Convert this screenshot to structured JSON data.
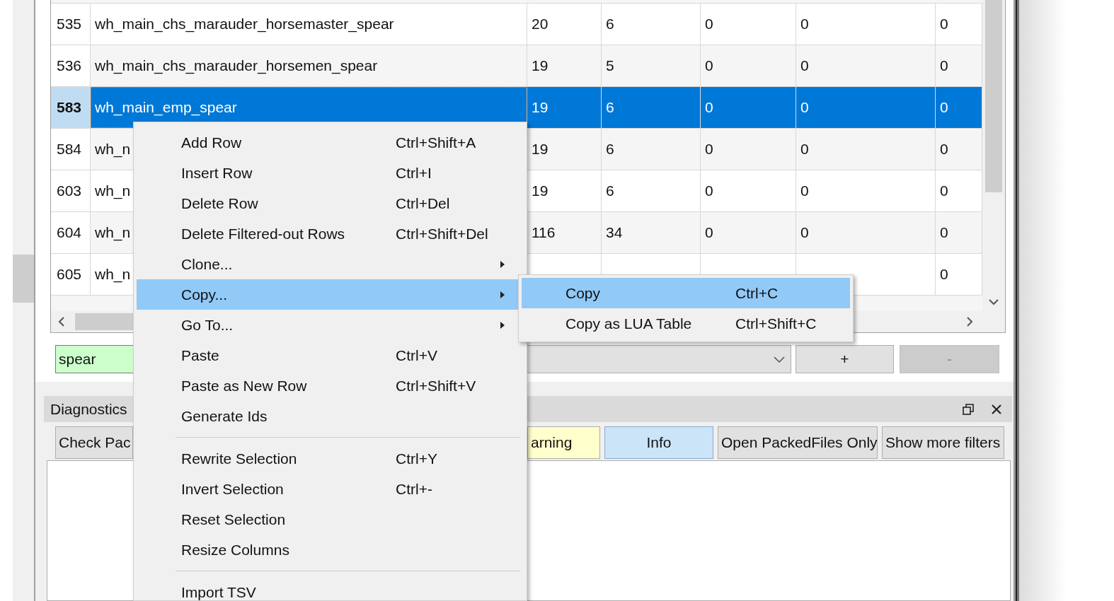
{
  "table": {
    "rows": [
      {
        "header": "535",
        "selected": false,
        "cells": [
          "wh_main_chs_marauder_horsemaster_spear",
          "20",
          "6",
          "0",
          "0",
          "0"
        ]
      },
      {
        "header": "536",
        "selected": false,
        "cells": [
          "wh_main_chs_marauder_horsemen_spear",
          "19",
          "5",
          "0",
          "0",
          "0"
        ]
      },
      {
        "header": "583",
        "selected": true,
        "cells": [
          "wh_main_emp_spear",
          "19",
          "6",
          "0",
          "0",
          "0"
        ]
      },
      {
        "header": "584",
        "selected": false,
        "cells": [
          "wh_n",
          "19",
          "6",
          "0",
          "0",
          "0"
        ]
      },
      {
        "header": "603",
        "selected": false,
        "cells": [
          "wh_n",
          "19",
          "6",
          "0",
          "0",
          "0"
        ]
      },
      {
        "header": "604",
        "selected": false,
        "cells": [
          "wh_n",
          "116",
          "34",
          "0",
          "0",
          "0"
        ]
      },
      {
        "header": "605",
        "selected": false,
        "cells": [
          "wh_n"
        ],
        "column_6": "0"
      }
    ]
  },
  "filter": {
    "value": "spear",
    "add_button": {
      "label": "+",
      "disabled": false
    },
    "remove_button": {
      "label": "-",
      "disabled": true
    }
  },
  "diagnostics": {
    "title": "Diagnostics",
    "buttons": [
      {
        "label": "Check Pac",
        "kind": "plain"
      },
      {
        "label": "arning",
        "kind": "warning"
      },
      {
        "label": "Info",
        "kind": "info"
      },
      {
        "label": "Open PackedFiles Only",
        "kind": "plain"
      },
      {
        "label": "Show more filters",
        "kind": "plain"
      }
    ]
  },
  "context_menu": {
    "items": [
      {
        "kind": "item",
        "label": "Add Row",
        "shortcut": "Ctrl+Shift+A",
        "submenu": false,
        "selected": false
      },
      {
        "kind": "item",
        "label": "Insert Row",
        "shortcut": "Ctrl+I",
        "submenu": false,
        "selected": false
      },
      {
        "kind": "item",
        "label": "Delete Row",
        "shortcut": "Ctrl+Del",
        "submenu": false,
        "selected": false
      },
      {
        "kind": "item",
        "label": "Delete Filtered-out Rows",
        "shortcut": "Ctrl+Shift+Del",
        "submenu": false,
        "selected": false
      },
      {
        "kind": "item",
        "label": "Clone...",
        "submenu": true,
        "selected": false
      },
      {
        "kind": "item",
        "label": "Copy...",
        "submenu": true,
        "selected": true
      },
      {
        "kind": "item",
        "label": "Go To...",
        "submenu": true,
        "selected": false
      },
      {
        "kind": "item",
        "label": "Paste",
        "shortcut": "Ctrl+V",
        "submenu": false,
        "selected": false
      },
      {
        "kind": "item",
        "label": "Paste as New Row",
        "shortcut": "Ctrl+Shift+V",
        "submenu": false,
        "selected": false
      },
      {
        "kind": "item",
        "label": "Generate Ids",
        "submenu": false,
        "selected": false
      },
      {
        "kind": "separator"
      },
      {
        "kind": "item",
        "label": "Rewrite Selection",
        "shortcut": "Ctrl+Y",
        "submenu": false,
        "selected": false
      },
      {
        "kind": "item",
        "label": "Invert Selection",
        "shortcut": "Ctrl+-",
        "submenu": false,
        "selected": false
      },
      {
        "kind": "item",
        "label": "Reset Selection",
        "submenu": false,
        "selected": false
      },
      {
        "kind": "item",
        "label": "Resize Columns",
        "submenu": false,
        "selected": false
      },
      {
        "kind": "separator"
      },
      {
        "kind": "item",
        "label": "Import TSV",
        "submenu": false,
        "selected": false
      }
    ]
  },
  "submenu": {
    "items": [
      {
        "label": "Copy",
        "shortcut": "Ctrl+C",
        "selected": true
      },
      {
        "label": "Copy as LUA Table",
        "shortcut": "Ctrl+Shift+C",
        "selected": false
      }
    ]
  }
}
